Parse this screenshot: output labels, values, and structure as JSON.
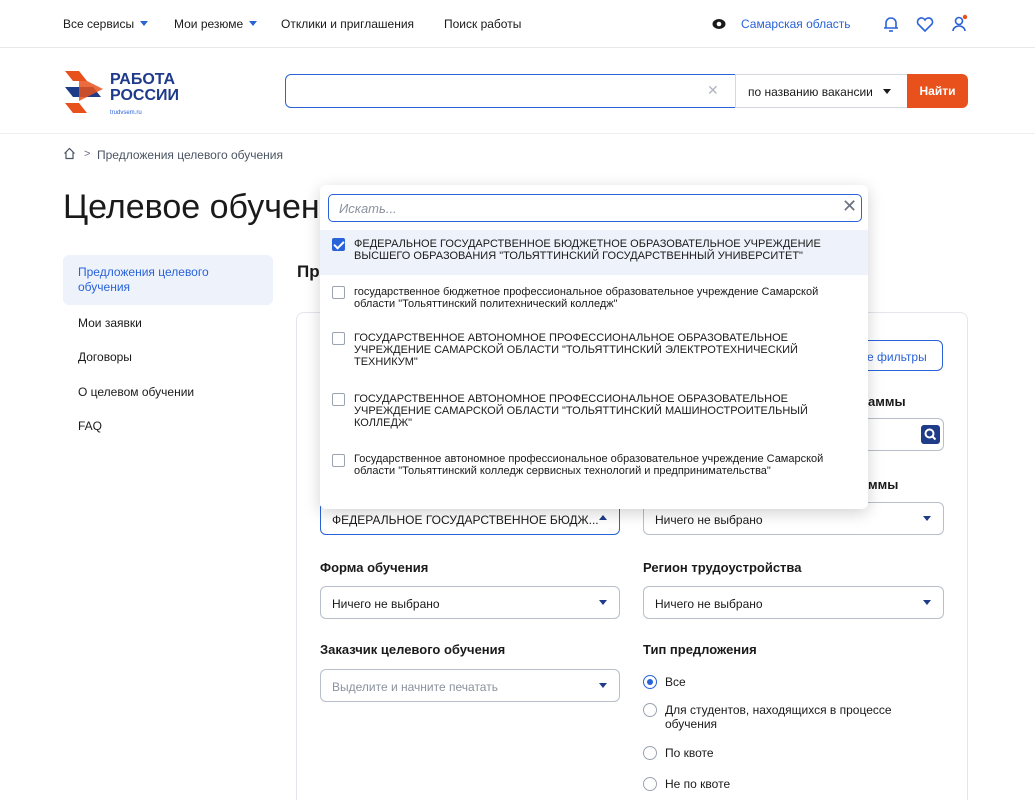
{
  "topnav": {
    "all_services": "Все сервисы",
    "my_resumes": "Мои резюме",
    "responses": "Отклики и приглашения",
    "job_search": "Поиск работы",
    "region": "Самарская область"
  },
  "header": {
    "logo_title_1": "РАБОТА",
    "logo_title_2": "РОССИИ",
    "logo_sub": "trudvsem.ru",
    "search_value": "",
    "search_mode": "по названию вакансии",
    "find_label": "Найти"
  },
  "breadcrumb": {
    "current": "Предложения целевого обучения"
  },
  "page_title": "Целевое обучение",
  "sidebar": {
    "items": [
      {
        "label": "Предложения целевого обучения"
      },
      {
        "label": "Мои заявки"
      },
      {
        "label": "Договоры"
      },
      {
        "label": "О целевом обучении"
      },
      {
        "label": "FAQ"
      }
    ]
  },
  "section_heading": "Пр",
  "filters": {
    "all_filters": "Все фильтры",
    "program_label_fragment": "аммы",
    "program_label_fragment2": "ммы",
    "org_selected": "ФЕДЕРАЛЬНОЕ ГОСУДАРСТВЕННОЕ БЮДЖ...",
    "program_select": "Ничего не выбрано",
    "form_label": "Форма обучения",
    "form_value": "Ничего не выбрано",
    "region_label": "Регион трудоустройства",
    "region_value": "Ничего не выбрано",
    "customer_label": "Заказчик целевого обучения",
    "customer_placeholder": "Выделите и начните печатать",
    "type_label": "Тип предложения",
    "type_options": [
      {
        "label": "Все",
        "selected": true
      },
      {
        "label": "Для студентов, находящихся в процессе обучения",
        "selected": false
      },
      {
        "label": "По квоте",
        "selected": false
      },
      {
        "label": "Не по квоте",
        "selected": false
      }
    ]
  },
  "dropdown": {
    "search_placeholder": "Искать...",
    "options": [
      {
        "label": "ФЕДЕРАЛЬНОЕ ГОСУДАРСТВЕННОЕ БЮДЖЕТНОЕ ОБРАЗОВАТЕЛЬНОЕ УЧРЕЖДЕНИЕ ВЫСШЕГО ОБРАЗОВАНИЯ \"ТОЛЬЯТТИНСКИЙ ГОСУДАРСТВЕННЫЙ УНИВЕРСИТЕТ\"",
        "checked": true
      },
      {
        "label": "государственное бюджетное профессиональное образовательное учреждение Самарской области \"Тольяттинский политехнический колледж\"",
        "checked": false
      },
      {
        "label": "ГОСУДАРСТВЕННОЕ АВТОНОМНОЕ ПРОФЕССИОНАЛЬНОЕ ОБРАЗОВАТЕЛЬНОЕ УЧРЕЖДЕНИЕ САМАРСКОЙ ОБЛАСТИ \"ТОЛЬЯТТИНСКИЙ ЭЛЕКТРОТЕХНИЧЕСКИЙ ТЕХНИКУМ\"",
        "checked": false
      },
      {
        "label": "ГОСУДАРСТВЕННОЕ АВТОНОМНОЕ ПРОФЕССИОНАЛЬНОЕ ОБРАЗОВАТЕЛЬНОЕ УЧРЕЖДЕНИЕ САМАРСКОЙ ОБЛАСТИ \"ТОЛЬЯТТИНСКИЙ МАШИНОСТРОИТЕЛЬНЫЙ КОЛЛЕДЖ\"",
        "checked": false
      },
      {
        "label": "Государственное автономное профессиональное образовательное учреждение Самарской области \"Тольяттинский колледж сервисных технологий и предпринимательства\"",
        "checked": false
      }
    ]
  },
  "colors": {
    "accent": "#2962d9",
    "brand_orange": "#e8511c",
    "navy": "#1f3c88"
  }
}
